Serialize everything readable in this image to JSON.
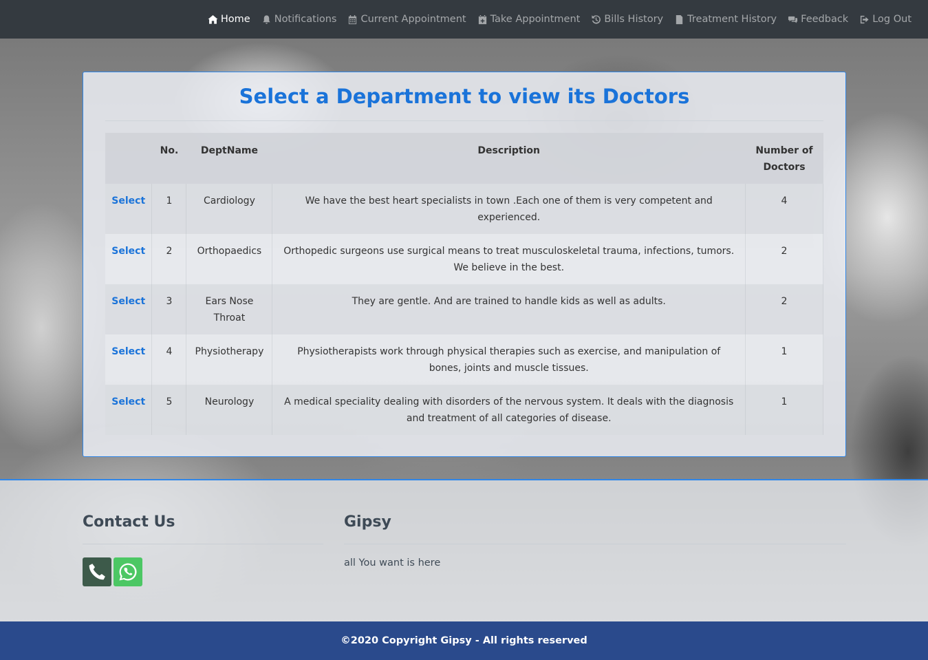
{
  "nav": {
    "items": [
      {
        "label": "Home",
        "icon": "home-icon"
      },
      {
        "label": "Notifications",
        "icon": "bell-icon"
      },
      {
        "label": "Current Appointment",
        "icon": "calendar-icon"
      },
      {
        "label": "Take Appointment",
        "icon": "calendar-plus-icon"
      },
      {
        "label": "Bills History",
        "icon": "history-icon"
      },
      {
        "label": "Treatment History",
        "icon": "file-icon"
      },
      {
        "label": "Feedback",
        "icon": "comments-icon"
      },
      {
        "label": "Log Out",
        "icon": "sign-out-icon"
      }
    ],
    "active_color": "#ffffff",
    "bar_color": "#343a40"
  },
  "main": {
    "title": "Select a Department to view its Doctors",
    "accent_color": "#1a73d9",
    "table": {
      "headers": [
        "",
        "No.",
        "DeptName",
        "Description",
        "Number of Doctors"
      ],
      "rows": [
        {
          "action": "Select",
          "no": "1",
          "name": "Cardiology",
          "description": "We have the best heart specialists in town .Each one of them is very competent and experienced.",
          "doctors": "4"
        },
        {
          "action": "Select",
          "no": "2",
          "name": "Orthopaedics",
          "description": "Orthopedic surgeons use surgical means to treat musculoskeletal trauma, infections, tumors. We believe in the best.",
          "doctors": "2"
        },
        {
          "action": "Select",
          "no": "3",
          "name": "Ears Nose Throat",
          "description": "They are gentle. And are trained to handle kids as well as adults.",
          "doctors": "2"
        },
        {
          "action": "Select",
          "no": "4",
          "name": "Physiotherapy",
          "description": "Physiotherapists work through physical therapies such as exercise, and manipulation of bones, joints and muscle tissues.",
          "doctors": "1"
        },
        {
          "action": "Select",
          "no": "5",
          "name": "Neurology",
          "description": "A medical speciality dealing with disorders of the nervous system. It deals with the diagnosis and treatment of all categories of disease.",
          "doctors": "1"
        }
      ]
    }
  },
  "footer": {
    "contact_heading": "Contact Us",
    "brand_heading": "Gipsy",
    "brand_text": "all You want is here",
    "phone_color": "#3d5a4a",
    "whatsapp_color": "#4cc764",
    "copyright": "©2020 Copyright Gipsy - All rights reserved",
    "bottom_color": "#2a4a8c"
  }
}
